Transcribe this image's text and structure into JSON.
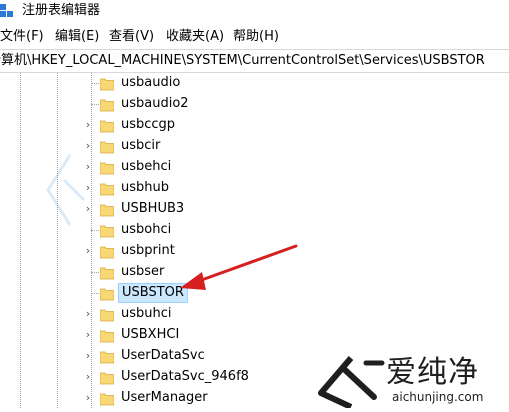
{
  "window": {
    "title": "注册表编辑器"
  },
  "menu": [
    "文件(F)",
    "编辑(E)",
    "查看(V)",
    "收藏夹(A)",
    "帮助(H)"
  ],
  "address": {
    "path": "计算机\\HKEY_LOCAL_MACHINE\\SYSTEM\\CurrentControlSet\\Services\\USBSTOR"
  },
  "tree": {
    "items": [
      {
        "label": "usbaudio",
        "expandable": false
      },
      {
        "label": "usbaudio2",
        "expandable": false
      },
      {
        "label": "usbccgp",
        "expandable": true
      },
      {
        "label": "usbcir",
        "expandable": true
      },
      {
        "label": "usbehci",
        "expandable": true
      },
      {
        "label": "usbhub",
        "expandable": true
      },
      {
        "label": "USBHUB3",
        "expandable": true
      },
      {
        "label": "usbohci",
        "expandable": false
      },
      {
        "label": "usbprint",
        "expandable": true
      },
      {
        "label": "usbser",
        "expandable": false
      },
      {
        "label": "USBSTOR",
        "expandable": false,
        "selected": true
      },
      {
        "label": "usbuhci",
        "expandable": true
      },
      {
        "label": "USBXHCI",
        "expandable": true
      },
      {
        "label": "UserDataSvc",
        "expandable": true
      },
      {
        "label": "UserDataSvc_946f8",
        "expandable": true
      },
      {
        "label": "UserManager",
        "expandable": true
      }
    ]
  },
  "watermark": {
    "name": "爱纯净",
    "url": "aichunjing.com"
  },
  "colors": {
    "arrow": "#d61f1f",
    "selection": "#cce8ff",
    "folder": "#f8d775"
  }
}
